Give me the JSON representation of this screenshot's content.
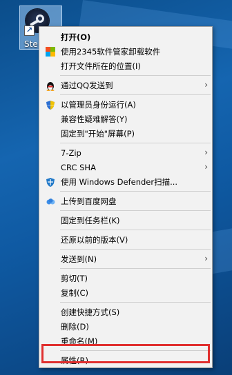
{
  "desktop_icon": {
    "label": "Ste"
  },
  "menu": {
    "items": [
      {
        "label": "打开(O)",
        "bold": true
      },
      {
        "label": "使用2345软件管家卸载软件",
        "icon": "2345-icon"
      },
      {
        "label": "打开文件所在的位置(I)"
      },
      {
        "label": "通过QQ发送到",
        "icon": "qq-penguin-icon",
        "submenu": true
      },
      {
        "label": "以管理员身份运行(A)",
        "icon": "uac-shield-icon"
      },
      {
        "label": "兼容性疑难解答(Y)"
      },
      {
        "label": "固定到\"开始\"屏幕(P)"
      },
      {
        "label": "7-Zip",
        "submenu": true
      },
      {
        "label": "CRC SHA",
        "submenu": true
      },
      {
        "label": "使用 Windows Defender扫描...",
        "icon": "defender-icon"
      },
      {
        "label": "上传到百度网盘",
        "icon": "baidu-cloud-icon"
      },
      {
        "label": "固定到任务栏(K)"
      },
      {
        "label": "还原以前的版本(V)"
      },
      {
        "label": "发送到(N)",
        "submenu": true
      },
      {
        "label": "剪切(T)"
      },
      {
        "label": "复制(C)"
      },
      {
        "label": "创建快捷方式(S)"
      },
      {
        "label": "删除(D)"
      },
      {
        "label": "重命名(M)"
      },
      {
        "label": "属性(R)"
      }
    ]
  },
  "colors": {
    "highlight_border": "#e0302f",
    "menu_bg": "#f2f2f2",
    "desktop": "#1565b0"
  }
}
